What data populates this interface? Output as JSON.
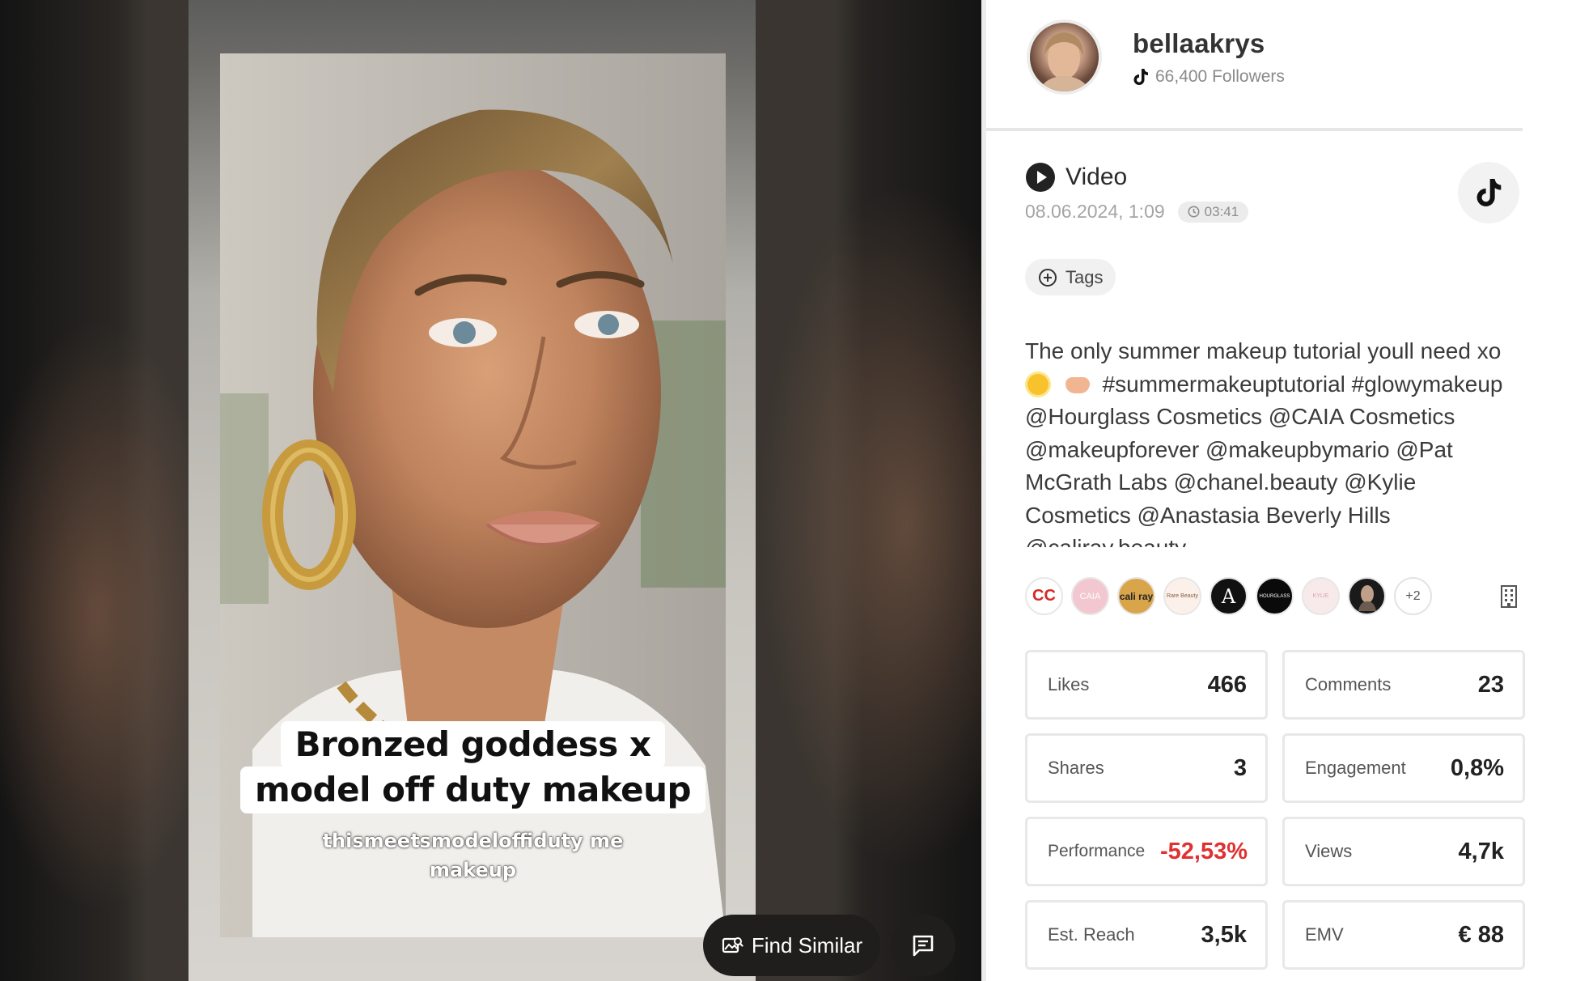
{
  "video": {
    "caption_line1": "Bronzed goddess x",
    "caption_line2": "model off duty makeup",
    "sub_caption_line1": "thismeetsmodeloffiduty me",
    "sub_caption_line2": "makeup",
    "find_similar_label": "Find Similar"
  },
  "profile": {
    "username": "bellaakrys",
    "followers": "66,400 Followers",
    "platform_icon": "tiktok-icon"
  },
  "post": {
    "type": "Video",
    "date": "08.06.2024, 1:09",
    "duration": "03:41",
    "tags_label": "Tags",
    "description_part1": "The only summer makeup tutorial youll need xo",
    "description_part2": "#summermakeuptutorial #glowymakeup @Hourglass Cosmetics @CAIA Cosmetics @makeupforever @makeupbymario @Pat McGrath Labs @chanel.beauty @Kylie Cosmetics @Anastasia Beverly Hills @caliray.beauty"
  },
  "brands": {
    "items": [
      {
        "name": "chanel",
        "text": "CC",
        "bg": "#ffffff",
        "fg": "#d62828"
      },
      {
        "name": "caia",
        "text": "CAIA",
        "bg": "#f2c7cf",
        "fg": "#ffffff"
      },
      {
        "name": "caliray",
        "text": "cali ray",
        "bg": "#d9a54a",
        "fg": "#222222"
      },
      {
        "name": "rare-beauty",
        "text": "Rare Beauty",
        "bg": "#fbf1ea",
        "fg": "#8a5a44"
      },
      {
        "name": "anastasia",
        "text": "A",
        "bg": "#111111",
        "fg": "#ffffff"
      },
      {
        "name": "hourglass",
        "text": "HOURGLASS",
        "bg": "#0a0a0a",
        "fg": "#ffffff"
      },
      {
        "name": "kylie",
        "text": "KYLIE",
        "bg": "#f8e9ea",
        "fg": "#d7a3a8"
      },
      {
        "name": "pat-mcgrath",
        "text": "",
        "bg": "#1a1a1a",
        "fg": "#ffffff"
      }
    ],
    "more": "+2"
  },
  "stats": {
    "likes_label": "Likes",
    "likes": "466",
    "comments_label": "Comments",
    "comments": "23",
    "shares_label": "Shares",
    "shares": "3",
    "engagement_label": "Engagement",
    "engagement": "0,8%",
    "performance_label": "Performance",
    "performance": "-52,53%",
    "views_label": "Views",
    "views": "4,7k",
    "reach_label": "Est. Reach",
    "reach": "3,5k",
    "emv_label": "EMV",
    "emv": "€ 88"
  },
  "colors": {
    "negative": "#e03131",
    "button_dark": "#1f1e1d"
  }
}
